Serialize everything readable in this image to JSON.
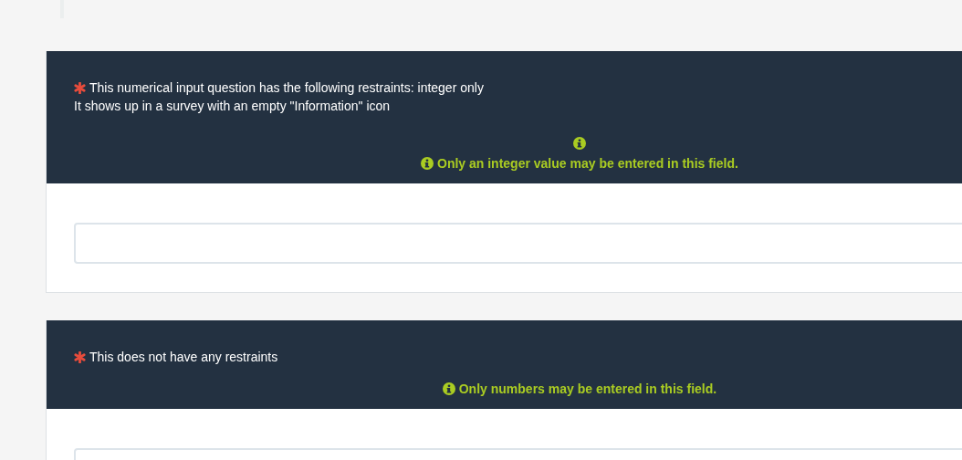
{
  "questions": [
    {
      "required": true,
      "lines": [
        "This numerical input question has the following restraints: integer only",
        "It shows up in a survey with an empty \"Information\" icon"
      ],
      "empty_info_icon": true,
      "tip": "Only an integer value may be entered in this field."
    },
    {
      "required": true,
      "lines": [
        "This does not have any restraints"
      ],
      "empty_info_icon": false,
      "tip": "Only numbers may be entered in this field."
    }
  ]
}
